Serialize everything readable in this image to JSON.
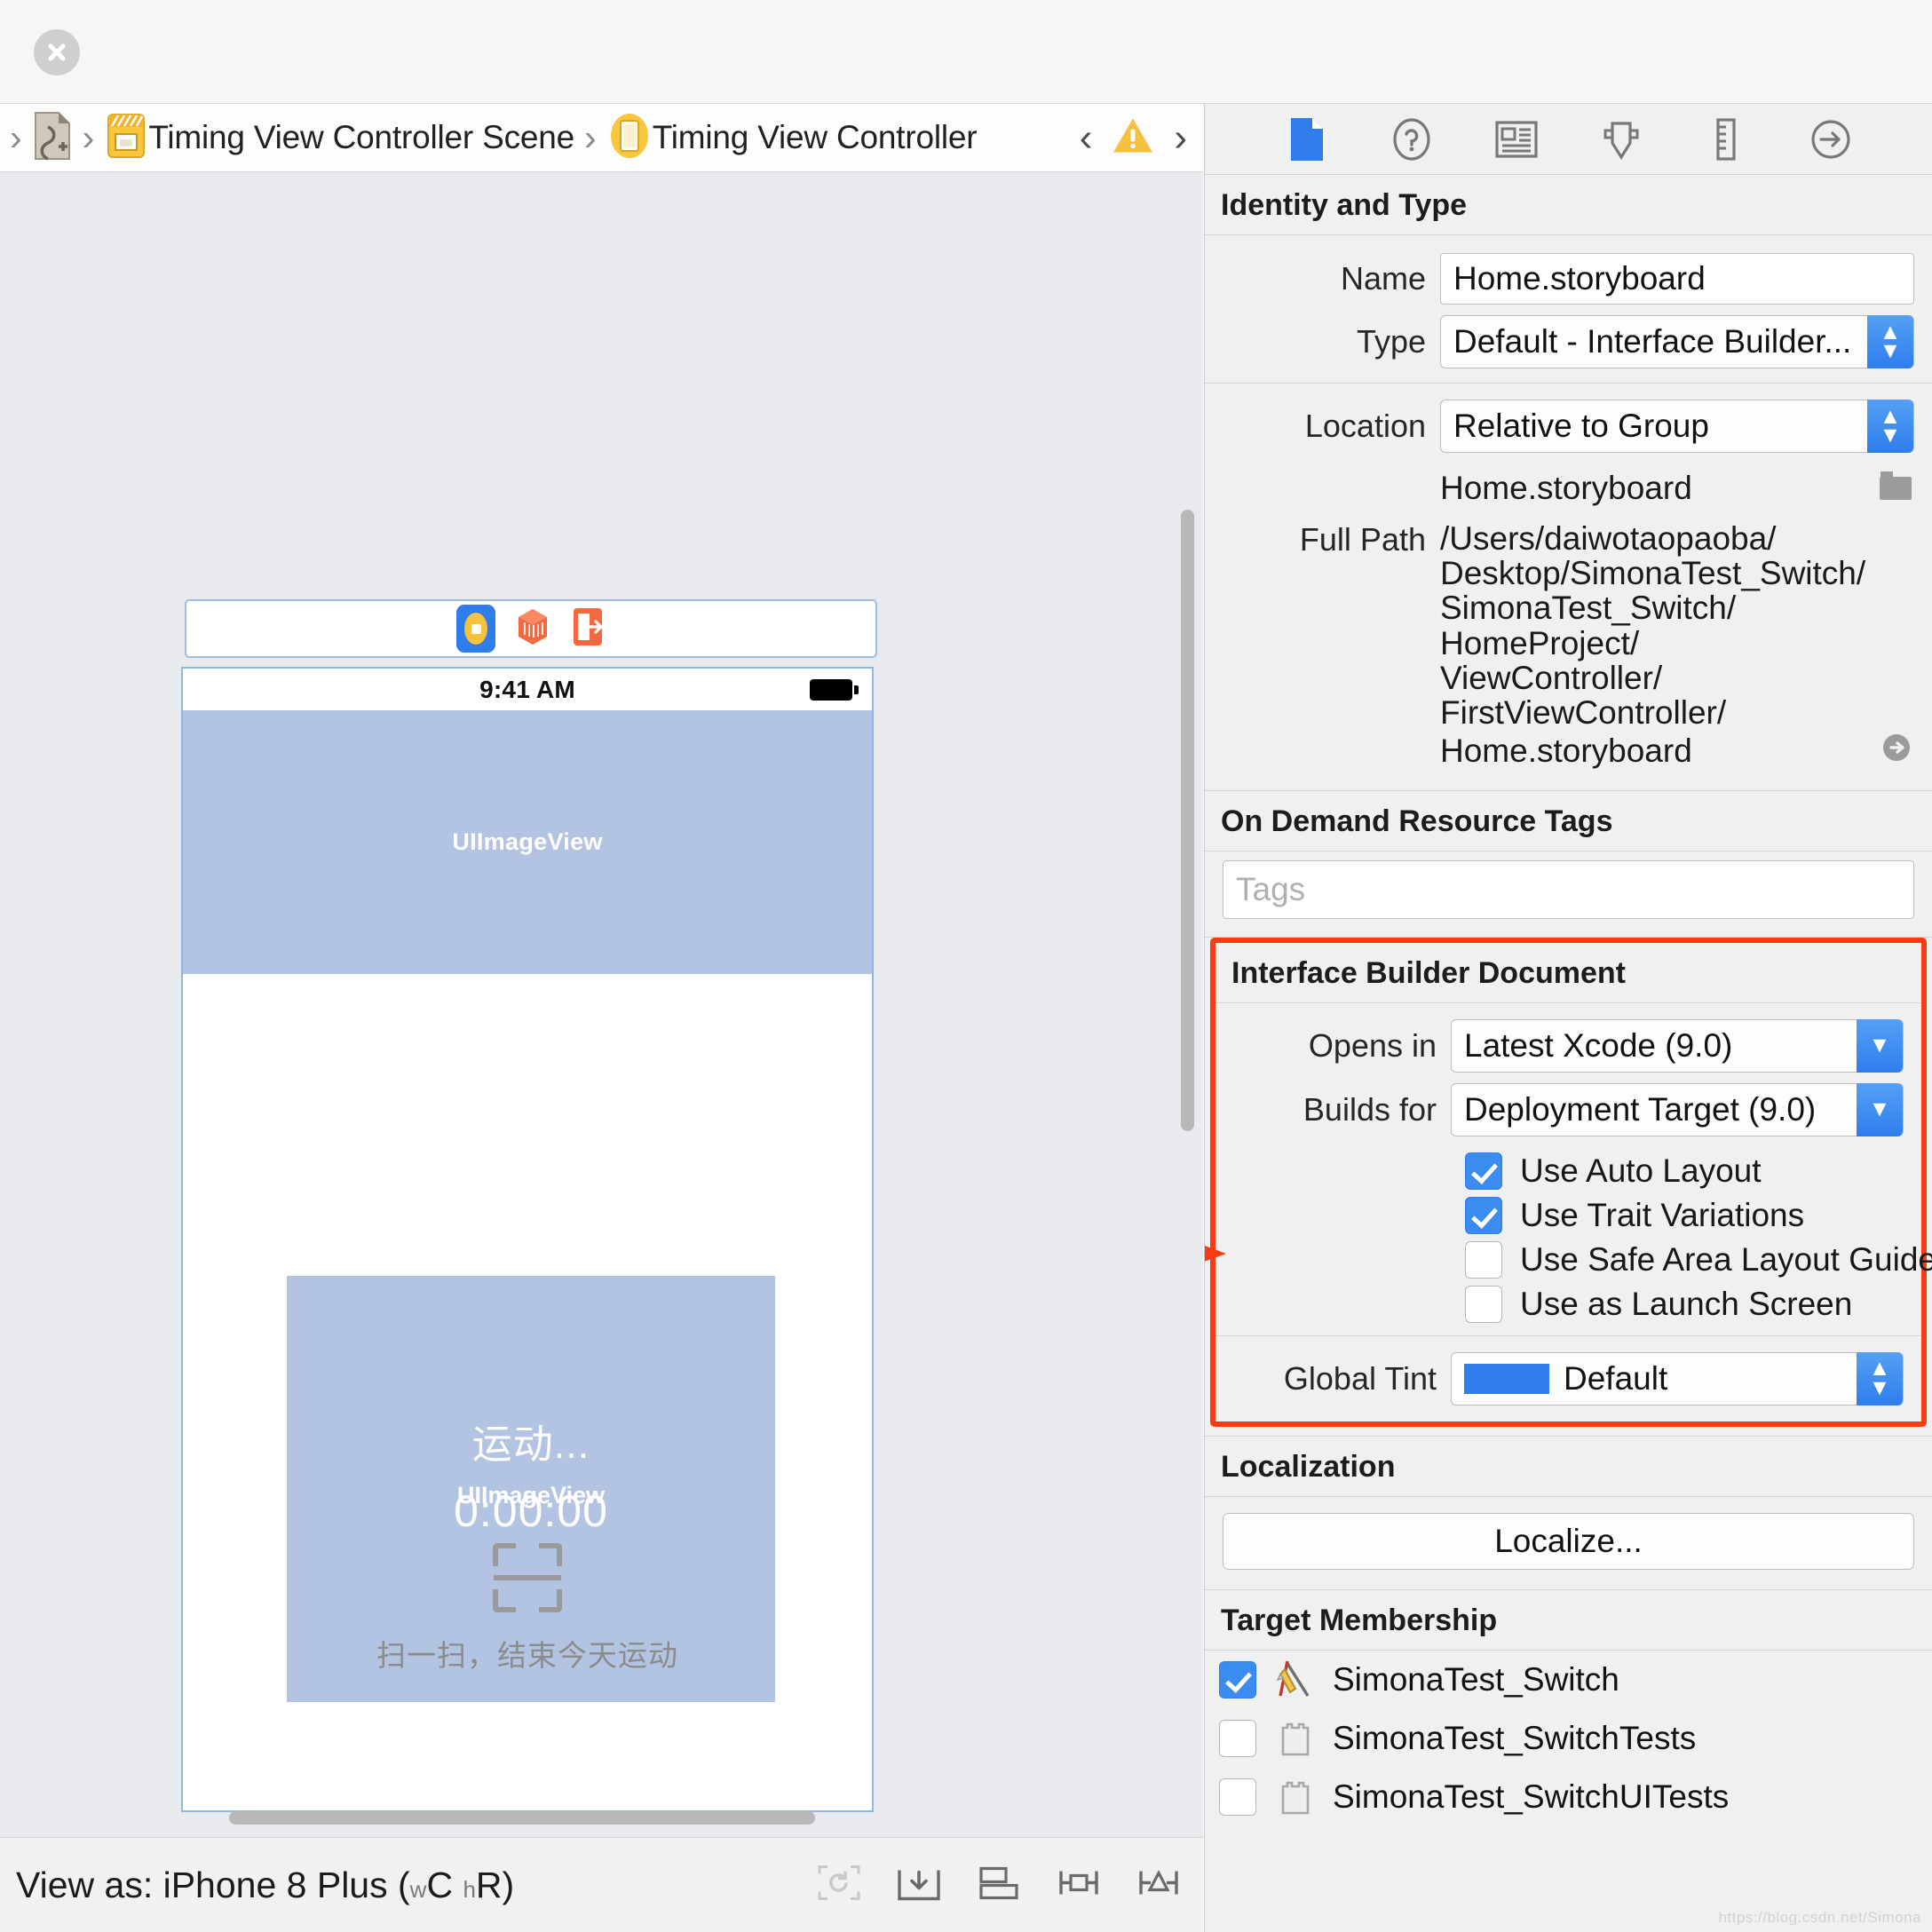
{
  "window": {
    "close_icon": "close-icon"
  },
  "jumpbar": {
    "items": [
      {
        "icon": "document-file-icon",
        "label": ""
      },
      {
        "icon": "storyboard-scene-icon",
        "label": "Timing View Controller Scene"
      },
      {
        "icon": "view-controller-icon",
        "label": "Timing View Controller"
      }
    ],
    "prev_label": "‹",
    "next_label": "›",
    "warning_icon": "warning-triangle-icon"
  },
  "canvas": {
    "scene_dock": {
      "view_controller_icon": "view-controller-icon",
      "first_responder_icon": "first-responder-icon",
      "exit_icon": "exit-icon"
    },
    "device": {
      "status_time": "9:41 AM",
      "battery_icon": "battery-icon",
      "hero_label": "UIImageView",
      "card_title": "运动...",
      "card_sub_label": "UIImageView",
      "card_timer": "0:00:00",
      "scan_icon": "scan-qr-icon",
      "scan_text": "扫一扫，结束今天运动"
    }
  },
  "bottombar": {
    "view_as_prefix": "View as: iPhone 8 Plus (",
    "view_as_w": "w",
    "view_as_wclass": "C",
    "view_as_h": "h",
    "view_as_hclass": "R",
    "view_as_suffix": ")",
    "icons": [
      "update-frames-icon",
      "embed-in-icon",
      "align-icon",
      "pin-icon",
      "resolve-auto-layout-icon"
    ]
  },
  "inspector": {
    "tabs": [
      {
        "name": "file-inspector-tab",
        "icon": "document-icon",
        "selected": true
      },
      {
        "name": "quick-help-inspector-tab",
        "icon": "question-circle-icon",
        "selected": false
      },
      {
        "name": "identity-inspector-tab",
        "icon": "identity-card-icon",
        "selected": false
      },
      {
        "name": "attributes-inspector-tab",
        "icon": "attributes-slider-icon",
        "selected": false
      },
      {
        "name": "size-inspector-tab",
        "icon": "ruler-icon",
        "selected": false
      },
      {
        "name": "connections-inspector-tab",
        "icon": "arrow-circle-icon",
        "selected": false
      }
    ],
    "identity_and_type": {
      "title": "Identity and Type",
      "name_label": "Name",
      "name_value": "Home.storyboard",
      "type_label": "Type",
      "type_value": "Default - Interface Builder...",
      "location_label": "Location",
      "location_value": "Relative to Group",
      "location_file": "Home.storyboard",
      "folder_icon": "folder-icon",
      "full_path_label": "Full Path",
      "full_path_lines": [
        "/Users/daiwotaopaoba/",
        "Desktop/SimonaTest_Switch/",
        "SimonaTest_Switch/",
        "HomeProject/",
        "ViewController/",
        "FirstViewController/",
        "Home.storyboard"
      ],
      "reveal_icon": "reveal-arrow-icon"
    },
    "on_demand_resource_tags": {
      "title": "On Demand Resource Tags",
      "tags_placeholder": "Tags",
      "tags_value": ""
    },
    "interface_builder_document": {
      "title": "Interface Builder Document",
      "highlight_color": "#fa3c12",
      "opens_in_label": "Opens in",
      "opens_in_value": "Latest Xcode (9.0)",
      "builds_for_label": "Builds for",
      "builds_for_value": "Deployment Target (9.0)",
      "checkboxes": [
        {
          "label": "Use Auto Layout",
          "checked": true
        },
        {
          "label": "Use Trait Variations",
          "checked": true
        },
        {
          "label": "Use Safe Area Layout Guides",
          "checked": false
        },
        {
          "label": "Use as Launch Screen",
          "checked": false
        }
      ],
      "global_tint_label": "Global Tint",
      "global_tint_value": "Default",
      "global_tint_color": "#2f7ded",
      "annotation_arrow": "red-pointer-arrow"
    },
    "localization": {
      "title": "Localization",
      "localize_button": "Localize..."
    },
    "target_membership": {
      "title": "Target Membership",
      "rows": [
        {
          "label": "SimonaTest_Switch",
          "checked": true,
          "icon": "xcode-app-target-icon"
        },
        {
          "label": "SimonaTest_SwitchTests",
          "checked": false,
          "icon": "test-bundle-icon"
        },
        {
          "label": "SimonaTest_SwitchUITests",
          "checked": false,
          "icon": "test-bundle-icon"
        }
      ]
    }
  },
  "watermark": "https://blog.csdn.net/Simona"
}
